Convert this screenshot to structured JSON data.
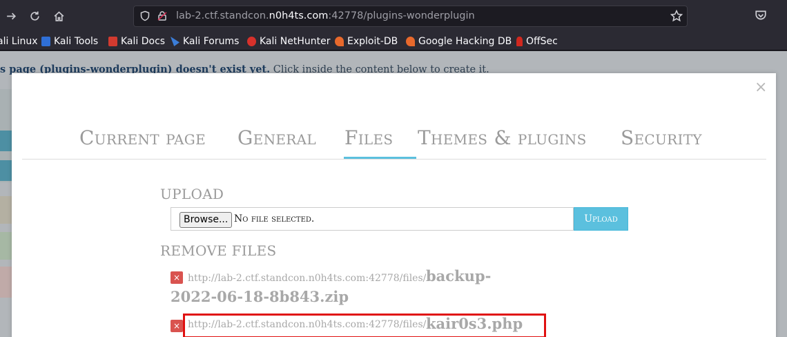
{
  "browser": {
    "url_prefix": "lab-2.ctf.standcon.",
    "url_host": "n0h4ts.com",
    "url_suffix": ":42778/plugins-wonderplugin",
    "bookmarks": [
      {
        "label": "ali Linux",
        "icon": "kali-icon"
      },
      {
        "label": "Kali Tools",
        "icon": "kali-tools-icon"
      },
      {
        "label": "Kali Docs",
        "icon": "kali-docs-icon"
      },
      {
        "label": "Kali Forums",
        "icon": "kali-forums-icon"
      },
      {
        "label": "Kali NetHunter",
        "icon": "nethunter-icon"
      },
      {
        "label": "Exploit-DB",
        "icon": "exploitdb-icon"
      },
      {
        "label": "Google Hacking DB",
        "icon": "ghdb-icon"
      },
      {
        "label": "OffSec",
        "icon": "offsec-icon"
      }
    ]
  },
  "page": {
    "notice_bold": "s page (plugins-wonderplugin) doesn't exist yet.",
    "notice_rest": " Click inside the content below to create it."
  },
  "modal": {
    "close_label": "×",
    "tabs": [
      "Current page",
      "General",
      "Files",
      "Themes & plugins",
      "Security"
    ],
    "active_tab": "Files",
    "upload_title": "UPLOAD",
    "browse_label": "Browse...",
    "no_file_label": "No file selected.",
    "upload_button": "Upload",
    "remove_title": "REMOVE FILES",
    "files": [
      {
        "url": "http://lab-2.ctf.standcon.n0h4ts.com:42778/files/",
        "name_line1": "backup-",
        "name_line2": "2022-06-18-8b843.zip"
      },
      {
        "url": "http://lab-2.ctf.standcon.n0h4ts.com:42778/files/",
        "name_line1": "kair0s3.php",
        "name_line2": ""
      }
    ],
    "delete_label": "×"
  }
}
